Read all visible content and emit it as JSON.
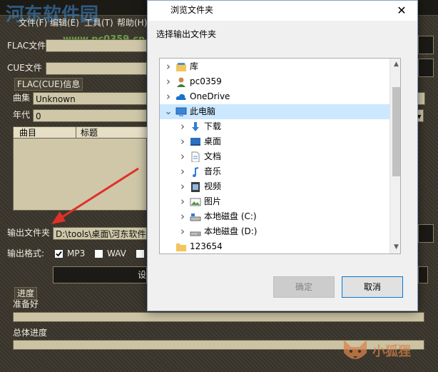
{
  "background_app": {
    "watermark_site": "河东软件园",
    "watermark_url": "www.pc0359.cn",
    "menu": [
      "文件(F)",
      "编辑(E)",
      "工具(T)",
      "帮助(H)"
    ],
    "flac_label": "FLAC文件",
    "cue_label": "CUE文件",
    "info_group": "FLAC(CUE)信息",
    "album_label": "曲集",
    "album_value": "Unknown",
    "year_label": "年代",
    "year_value": "0",
    "track_columns": [
      "曲目",
      "标题"
    ],
    "output_folder_label": "输出文件夹",
    "output_folder_value": "D:\\tools\\桌面\\河东软件园",
    "output_format_label": "输出格式:",
    "formats": [
      {
        "label": "MP3",
        "checked": true
      },
      {
        "label": "WAV",
        "checked": false
      }
    ],
    "settings_button_fragment": "设",
    "progress_group": "进度",
    "status_text": "准备好",
    "total_progress_label": "总体进度",
    "right_watermark": "小狐狸",
    "accent_color": "#e0302a"
  },
  "dialog": {
    "title": "浏览文件夹",
    "close_glyph": "✕",
    "instruction": "选择输出文件夹",
    "tree": [
      {
        "label": "库",
        "icon": "library-icon",
        "level": 0,
        "expanded": false,
        "selected": false
      },
      {
        "label": "pc0359",
        "icon": "user-icon",
        "level": 0,
        "expanded": false,
        "selected": false
      },
      {
        "label": "OneDrive",
        "icon": "cloud-icon",
        "level": 0,
        "expanded": false,
        "selected": false
      },
      {
        "label": "此电脑",
        "icon": "computer-icon",
        "level": 0,
        "expanded": true,
        "selected": true
      },
      {
        "label": "下载",
        "icon": "download-icon",
        "level": 1,
        "expanded": false,
        "selected": false
      },
      {
        "label": "桌面",
        "icon": "desktop-icon",
        "level": 1,
        "expanded": false,
        "selected": false
      },
      {
        "label": "文档",
        "icon": "document-icon",
        "level": 1,
        "expanded": false,
        "selected": false
      },
      {
        "label": "音乐",
        "icon": "music-icon",
        "level": 1,
        "expanded": false,
        "selected": false
      },
      {
        "label": "视频",
        "icon": "video-icon",
        "level": 1,
        "expanded": false,
        "selected": false
      },
      {
        "label": "图片",
        "icon": "picture-icon",
        "level": 1,
        "expanded": false,
        "selected": false
      },
      {
        "label": "本地磁盘 (C:)",
        "icon": "drive-c-icon",
        "level": 1,
        "expanded": false,
        "selected": false
      },
      {
        "label": "本地磁盘 (D:)",
        "icon": "drive-d-icon",
        "level": 1,
        "expanded": false,
        "selected": false
      },
      {
        "label": "123654",
        "icon": "folder-icon",
        "level": 0,
        "expanded": null,
        "selected": false
      }
    ],
    "ok_label": "确定",
    "cancel_label": "取消",
    "ok_enabled": false
  }
}
